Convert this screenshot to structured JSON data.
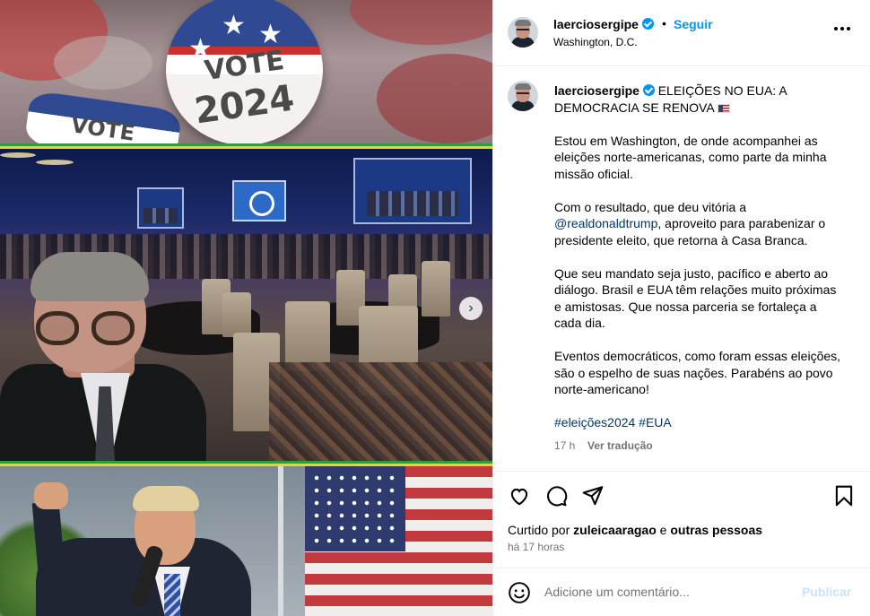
{
  "post": {
    "username": "laerciosergipe",
    "follow_label": "Seguir",
    "separator": "•",
    "location": "Washington, D.C.",
    "caption": {
      "username": "laerciosergipe",
      "title": "ELEIÇÕES NO EUA: A DEMOCRACIA SE RENOVA",
      "p1": "Estou em Washington, de onde acompanhei as eleições norte-americanas, como parte da minha missão oficial.",
      "p2_before": "Com o resultado, que deu vitória a ",
      "p2_mention": "@realdonaldtrump",
      "p2_after": ", aproveito para parabenizar o presidente eleito, que retorna à Casa Branca.",
      "p3": "Que seu mandato seja justo, pacífico e aberto ao diálogo. Brasil e EUA têm relações muito próximas e amistosas. Que nossa parceria se fortaleça a cada dia.",
      "p4": "Eventos democráticos, como foram essas eleições, são o espelho de suas nações. Parabéns ao povo norte-americano!",
      "hashtags": "#eleições2024 #EUA"
    },
    "caption_age": "17 h",
    "translate_label": "Ver tradução",
    "likes": {
      "prefix": "Curtido por ",
      "user": "zuleicaaragao",
      "conj": " e ",
      "others": "outras pessoas"
    },
    "posted_ago": "há 17 horas",
    "comment_placeholder": "Adicione um comentário...",
    "publish_label": "Publicar"
  },
  "media": {
    "badge_word_1": "VOTE",
    "badge_word_2": "2024",
    "badge_small_word": "VOTE",
    "has_next": true
  },
  "icons": [
    "verified-badge-icon",
    "more-options-icon",
    "heart-icon",
    "comment-icon",
    "share-icon",
    "bookmark-icon",
    "emoji-icon",
    "chevron-right-icon"
  ],
  "colors": {
    "link": "#00376b",
    "accent": "#0095f6",
    "muted": "#737373",
    "publish_disabled": "#c7e4fb"
  }
}
